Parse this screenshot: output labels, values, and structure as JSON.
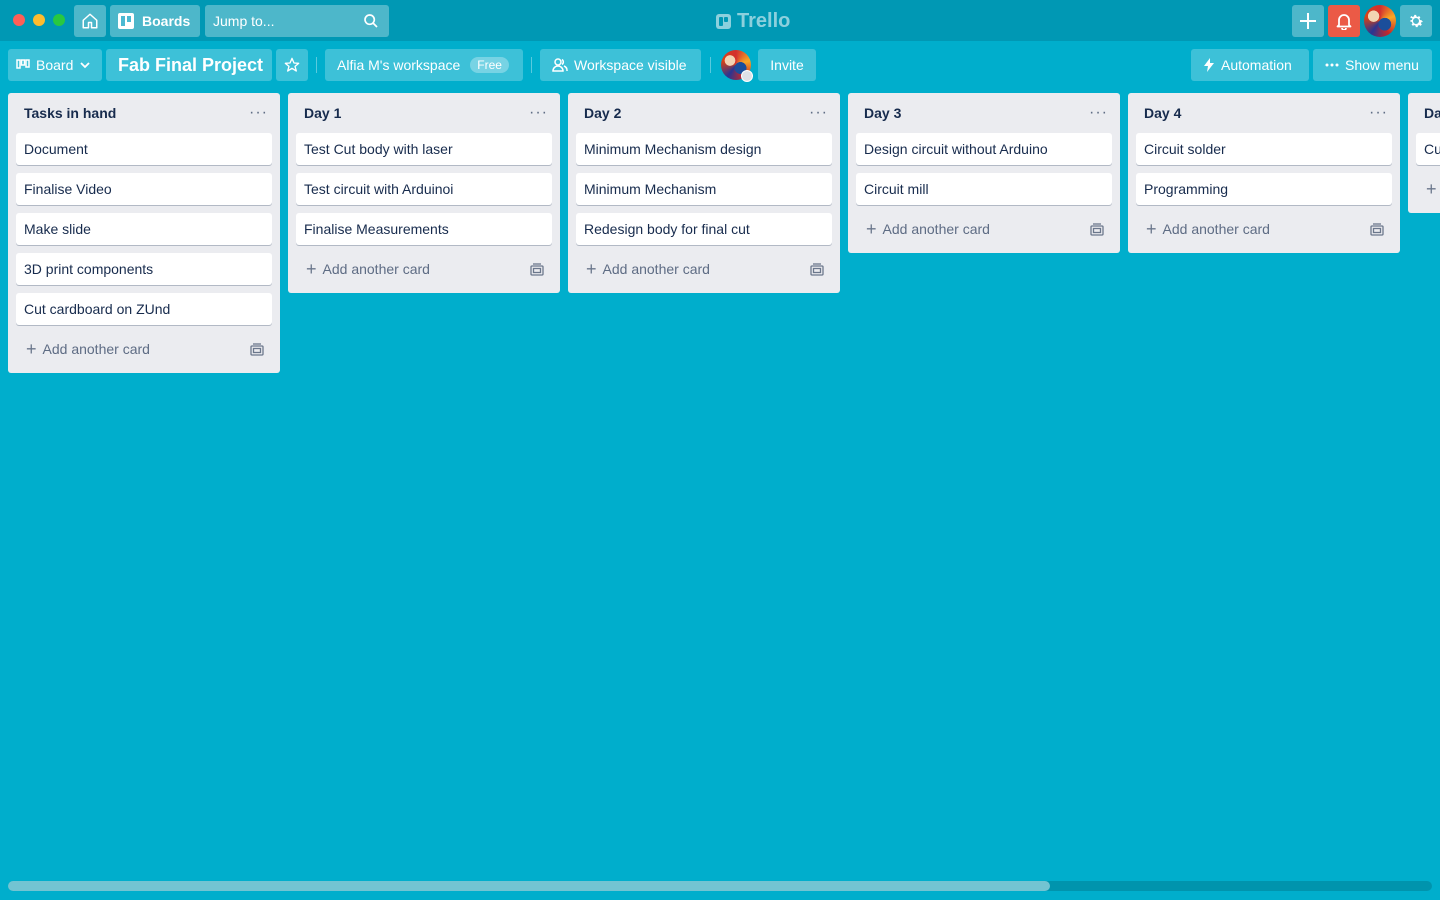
{
  "topbar": {
    "boards_label": "Boards",
    "search_placeholder": "Jump to...",
    "logo_text": "Trello"
  },
  "board_header": {
    "view_label": "Board",
    "title": "Fab Final Project",
    "workspace_label": "Alfia M's workspace",
    "workspace_badge": "Free",
    "visibility_label": "Workspace visible",
    "invite_label": "Invite",
    "automation_label": "Automation",
    "show_menu_label": "Show menu"
  },
  "lists": [
    {
      "title": "Tasks in hand",
      "cards": [
        "Document",
        "Finalise Video",
        "Make slide",
        "3D print components",
        "Cut cardboard on ZUnd"
      ],
      "add_label": "Add another card"
    },
    {
      "title": "Day 1",
      "cards": [
        "Test Cut body with laser",
        "Test circuit with Arduinoi",
        "Finalise Measurements"
      ],
      "add_label": "Add another card"
    },
    {
      "title": "Day 2",
      "cards": [
        "Minimum Mechanism design",
        "Minimum Mechanism",
        "Redesign body for final cut"
      ],
      "add_label": "Add another card"
    },
    {
      "title": "Day 3",
      "cards": [
        "Design circuit without Arduino",
        "Circuit mill"
      ],
      "add_label": "Add another card"
    },
    {
      "title": "Day 4",
      "cards": [
        "Circuit solder",
        "Programming"
      ],
      "add_label": "Add another card"
    }
  ],
  "partial_list": {
    "title": "Da",
    "first_card": "Cu"
  },
  "colors": {
    "board_background": "#00AECC",
    "topbar": "#0098B4",
    "notification": "#EB5A46",
    "list_background": "#EBECF0"
  },
  "icons": [
    "home-icon",
    "boards-icon",
    "search-icon",
    "plus-icon",
    "bell-icon",
    "gear-icon",
    "star-icon",
    "people-icon",
    "lightning-icon",
    "ellipsis-icon",
    "card-template-icon"
  ]
}
